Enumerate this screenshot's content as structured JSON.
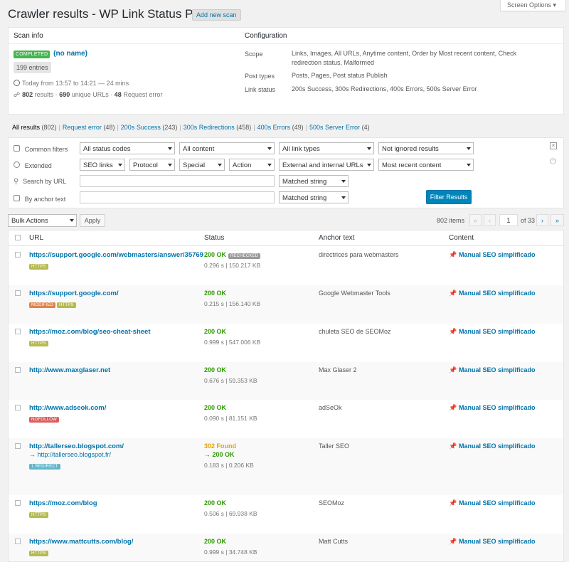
{
  "header": {
    "title": "Crawler results - WP Link Status Pro",
    "add_new": "Add new scan",
    "screen_options": "Screen Options ▾"
  },
  "scan_info": {
    "heading": "Scan info",
    "status_badge": "COMPLETED",
    "name": "(no name)",
    "entries": "199 entries",
    "time": "Today from 13:57 to 14:21 — 24 mins",
    "results_num": "802",
    "results_label": "results ·",
    "unique_num": "690",
    "unique_label": "unique URLs ·",
    "error_num": "48",
    "error_label": "Request error"
  },
  "configuration": {
    "heading": "Configuration",
    "scope_label": "Scope",
    "scope_value": "Links, Images, All URLs, Anytime content, Order by Most recent content, Check redirection status, Malformed",
    "post_types_label": "Post types",
    "post_types_value": "Posts, Pages, Post status Publish",
    "link_status_label": "Link status",
    "link_status_value": "200s Success, 300s Redirections, 400s Errors, 500s Server Error"
  },
  "tabs": [
    {
      "label": "All results",
      "count": "(802)"
    },
    {
      "label": "Request error",
      "count": "(48)"
    },
    {
      "label": "200s Success",
      "count": "(243)"
    },
    {
      "label": "300s Redirections",
      "count": "(458)"
    },
    {
      "label": "400s Errors",
      "count": "(49)"
    },
    {
      "label": "500s Server Error",
      "count": "(4)"
    }
  ],
  "filters": {
    "common_label": "Common filters",
    "extended_label": "Extended",
    "search_url_label": "Search by URL",
    "anchor_label": "By anchor text",
    "status_codes": "All status codes",
    "content": "All content",
    "link_types": "All link types",
    "ignored": "Not ignored results",
    "seo_links": "SEO links",
    "protocol": "Protocol",
    "special": "Special",
    "action": "Action",
    "ext_int": "External and internal URLs",
    "recent": "Most recent content",
    "matched1": "Matched string",
    "matched2": "Matched string",
    "filter_button": "Filter Results"
  },
  "bulk": {
    "actions": "Bulk Actions",
    "apply": "Apply",
    "items": "802 items",
    "first": "«",
    "prev": "‹",
    "page": "1",
    "of": "of 33",
    "next": "›",
    "last": "»"
  },
  "columns": {
    "url": "URL",
    "status": "Status",
    "anchor": "Anchor text",
    "content": "Content"
  },
  "rows": [
    {
      "url": "https://support.google.com/webmasters/answer/35769",
      "tags": [
        "HTTPS"
      ],
      "status": "200 OK",
      "extra": "RECHECKED",
      "time": "0.296 s",
      "size": "150.217 KB",
      "anchor": "directrices para webmasters",
      "content": "Manual SEO simplificado"
    },
    {
      "url": "https://support.google.com/",
      "tags": [
        "MODIFIED",
        "HTTPS"
      ],
      "status": "200 OK",
      "time": "0.215 s",
      "size": "156.140 KB",
      "anchor": "Google Webmaster Tools",
      "content": "Manual SEO simplificado"
    },
    {
      "url": "https://moz.com/blog/seo-cheat-sheet",
      "tags": [
        "HTTPS"
      ],
      "status": "200 OK",
      "time": "0.999 s",
      "size": "547.006 KB",
      "anchor": "chuleta SEO de SEOMoz",
      "content": "Manual SEO simplificado"
    },
    {
      "url": "http://www.maxglaser.net",
      "tags": [],
      "status": "200 OK",
      "time": "0.676 s",
      "size": "59.353 KB",
      "anchor": "Max Glaser 2",
      "content": "Manual SEO simplificado"
    },
    {
      "url": "http://www.adseok.com/",
      "tags": [
        "NOFOLLOW"
      ],
      "status": "200 OK",
      "time": "0.090 s",
      "size": "81.151 KB",
      "anchor": "adSeOk",
      "content": "Manual SEO simplificado"
    },
    {
      "url": "http://tallerseo.blogspot.com/",
      "redirect_url": "→ http://tallerseo.blogspot.fr/",
      "tags": [
        "1 REDIRECT"
      ],
      "status": "302 Found",
      "status2": "→ 200 OK",
      "time": "0.183 s",
      "size": "0.206 KB",
      "anchor": "Taller SEO",
      "content": "Manual SEO simplificado"
    },
    {
      "url": "https://moz.com/blog",
      "tags": [
        "HTTPS"
      ],
      "status": "200 OK",
      "time": "0.506 s",
      "size": "69.938 KB",
      "anchor": "SEOMoz",
      "content": "Manual SEO simplificado"
    },
    {
      "url": "https://www.mattcutts.com/blog/",
      "tags": [
        "HTTPS"
      ],
      "status": "200 OK",
      "time": "0.999 s",
      "size": "34.748 KB",
      "anchor": "Matt Cutts",
      "content": "Manual SEO simplificado"
    }
  ],
  "colors": {
    "accent": "#0073aa",
    "success": "#2c9b00",
    "warning": "#e5a100",
    "primary_button": "#0085ba"
  }
}
